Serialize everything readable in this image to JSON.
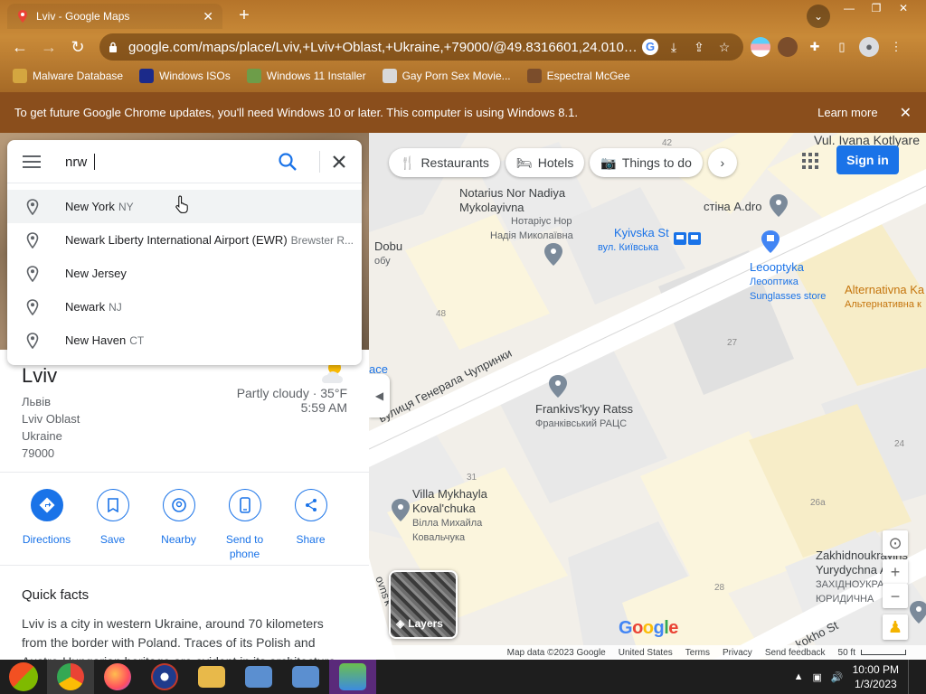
{
  "browser": {
    "tab_title": "Lviv - Google Maps",
    "url": "google.com/maps/place/Lviv,+Lviv+Oblast,+Ukraine,+79000/@49.8316601,24.010…",
    "bookmarks": [
      {
        "label": "Malware Database",
        "color": "#d4a640"
      },
      {
        "label": "Windows ISOs",
        "color": "#1b2a8a"
      },
      {
        "label": "Windows 11 Installer",
        "color": "#6d9d49"
      },
      {
        "label": "Gay Porn Sex Movie...",
        "color": "#d9d9d9"
      },
      {
        "label": "Espectral McGee",
        "color": "#7b4d2b"
      }
    ],
    "infobar_message": "To get future Google Chrome updates, you'll need Windows 10 or later. This computer is using Windows 8.1.",
    "infobar_link": "Learn more"
  },
  "search": {
    "query": "nrw",
    "suggestions": [
      {
        "main_bold": "New",
        "main_rest": " York",
        "secondary": "NY"
      },
      {
        "main_bold": "New",
        "main_rest": "ark Liberty International Airport (EWR)",
        "secondary": "Brewster R..."
      },
      {
        "main_bold": "New",
        "main_rest": " Jersey",
        "secondary": ""
      },
      {
        "main_bold": "New",
        "main_rest": "ark",
        "secondary": "NJ"
      },
      {
        "main_bold": "New",
        "main_rest": " Haven",
        "secondary": "CT"
      }
    ]
  },
  "place": {
    "name": "Lviv",
    "address_lines": [
      "Львів",
      "Lviv Oblast",
      "Ukraine",
      "79000"
    ],
    "weather": "Partly cloudy · 35°F",
    "time": "5:59 AM",
    "actions": [
      "Directions",
      "Save",
      "Nearby",
      "Send to",
      "phone",
      "Share"
    ],
    "quick_facts_title": "Quick facts",
    "quick_facts_text": "Lviv is a city in western Ukraine, around 70 kilometers from the border with Poland. Traces of its Polish and Austro-Hungarian heritage are evident in its architecture"
  },
  "map": {
    "chips": [
      "Restaurants",
      "Hotels",
      "Things to do"
    ],
    "sign_in": "Sign in",
    "layers": "Layers",
    "google": "Google",
    "street_main": "вулиця Генерала Чупринки",
    "street_top": "Vul. Ivana Kotlyare",
    "street_bottom": "kokho St",
    "street_left": "ovns'k",
    "label_place": "ace",
    "pois": {
      "notarius": {
        "name1": "Notarius Nor Nadiya",
        "name2": "Mykolayivna",
        "sub1": "Нотаріус Нор",
        "sub2": "Надія Миколаївна"
      },
      "kyivska": {
        "name": "Kyivska St",
        "sub": "вул. Київська"
      },
      "dobu": {
        "name": "Dobu",
        "sub": "обу"
      },
      "stina": {
        "name": "стіна A.dro"
      },
      "leooptyka": {
        "name": "Leooptyka",
        "sub1": "Леооптика",
        "sub2": "Sunglasses store"
      },
      "alternativna": {
        "name": "Alternativna Ka",
        "sub": "Альтернативна к"
      },
      "frankivskyy": {
        "name": "Frankivs'kyy Ratss",
        "sub": "Франківський РАЦС"
      },
      "villa": {
        "name1": "Villa Mykhayla",
        "name2": "Koval'chuka",
        "sub1": "Вілла Михайла",
        "sub2": "Ковальчука"
      },
      "zakhidno": {
        "name1": "Zakhidnoukrayins",
        "name2": "Yurydychna Aka",
        "sub1": "ЗАХІДНОУКРАЇНСЬ",
        "sub2": "ЮРИДИЧНА"
      }
    },
    "numbers": [
      "42",
      "48",
      "27",
      "31",
      "24",
      "26a",
      "28"
    ],
    "footer": [
      "Map data ©2023 Google",
      "United States",
      "Terms",
      "Privacy",
      "Send feedback",
      "50 ft"
    ]
  },
  "taskbar": {
    "time": "10:00 PM",
    "date": "1/3/2023"
  }
}
